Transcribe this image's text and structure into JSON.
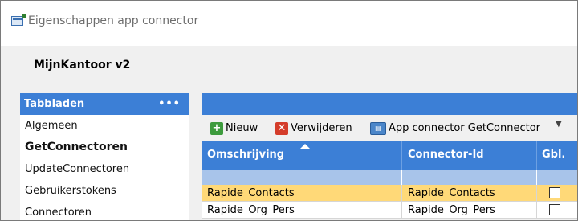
{
  "window": {
    "title": "Eigenschappen app connector"
  },
  "company": {
    "name": "MijnKantoor v2"
  },
  "sidebar": {
    "header": "Tabbladen",
    "more": "•••",
    "items": [
      {
        "label": "Algemeen",
        "active": false
      },
      {
        "label": "GetConnectoren",
        "active": true
      },
      {
        "label": "UpdateConnectoren",
        "active": false
      },
      {
        "label": "Gebruikerstokens",
        "active": false
      },
      {
        "label": "Connectoren",
        "active": false
      }
    ]
  },
  "toolbar": {
    "new_label": "Nieuw",
    "delete_label": "Verwijderen",
    "connector_label": "App connector GetConnector"
  },
  "grid": {
    "columns": [
      "Omschrijving",
      "Connector-Id",
      "Gbl."
    ],
    "rows": [
      {
        "description": "Rapide_Contacts",
        "connector_id": "Rapide_Contacts",
        "global": false,
        "selected": true
      },
      {
        "description": "Rapide_Org_Pers",
        "connector_id": "Rapide_Org_Pers",
        "global": false,
        "selected": false
      }
    ]
  },
  "colors": {
    "accent": "#3c7fd6",
    "filter_row": "#a8c4ea",
    "selected_row": "#ffd978"
  }
}
